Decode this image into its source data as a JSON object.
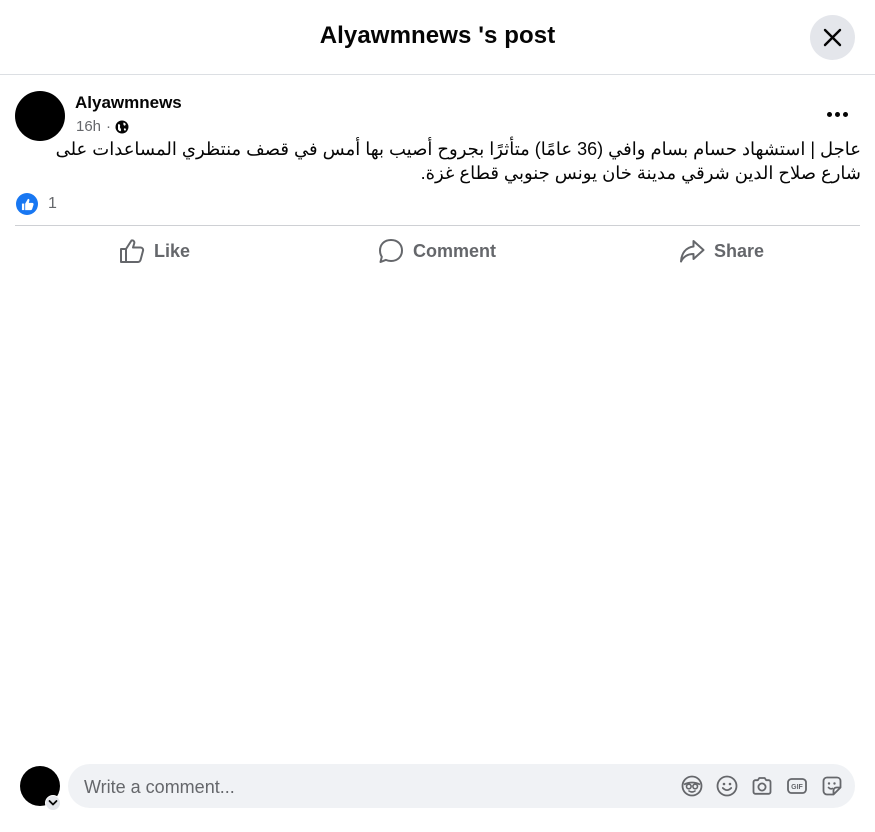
{
  "header": {
    "title": "Alyawmnews 's post"
  },
  "post": {
    "author": "Alyawmnews",
    "time": "16h",
    "separator": "·",
    "privacy_icon": "globe-icon",
    "text": "عاجل | استشهاد حسام بسام وافي (36 عامًا) متأثرًا بجروح أصيب بها أمس في قصف منتظري المساعدات على شارع صلاح الدين شرقي مدينة خان يونس جنوبي قطاع غزة."
  },
  "reactions": {
    "icon": "like-icon",
    "count": "1",
    "color": "#1877f2"
  },
  "actions": {
    "like": "Like",
    "comment": "Comment",
    "share": "Share"
  },
  "composer": {
    "placeholder": "Write a comment...",
    "icons": [
      "avatar-icon",
      "emoji-icon",
      "camera-icon",
      "gif-icon",
      "sticker-icon"
    ]
  }
}
